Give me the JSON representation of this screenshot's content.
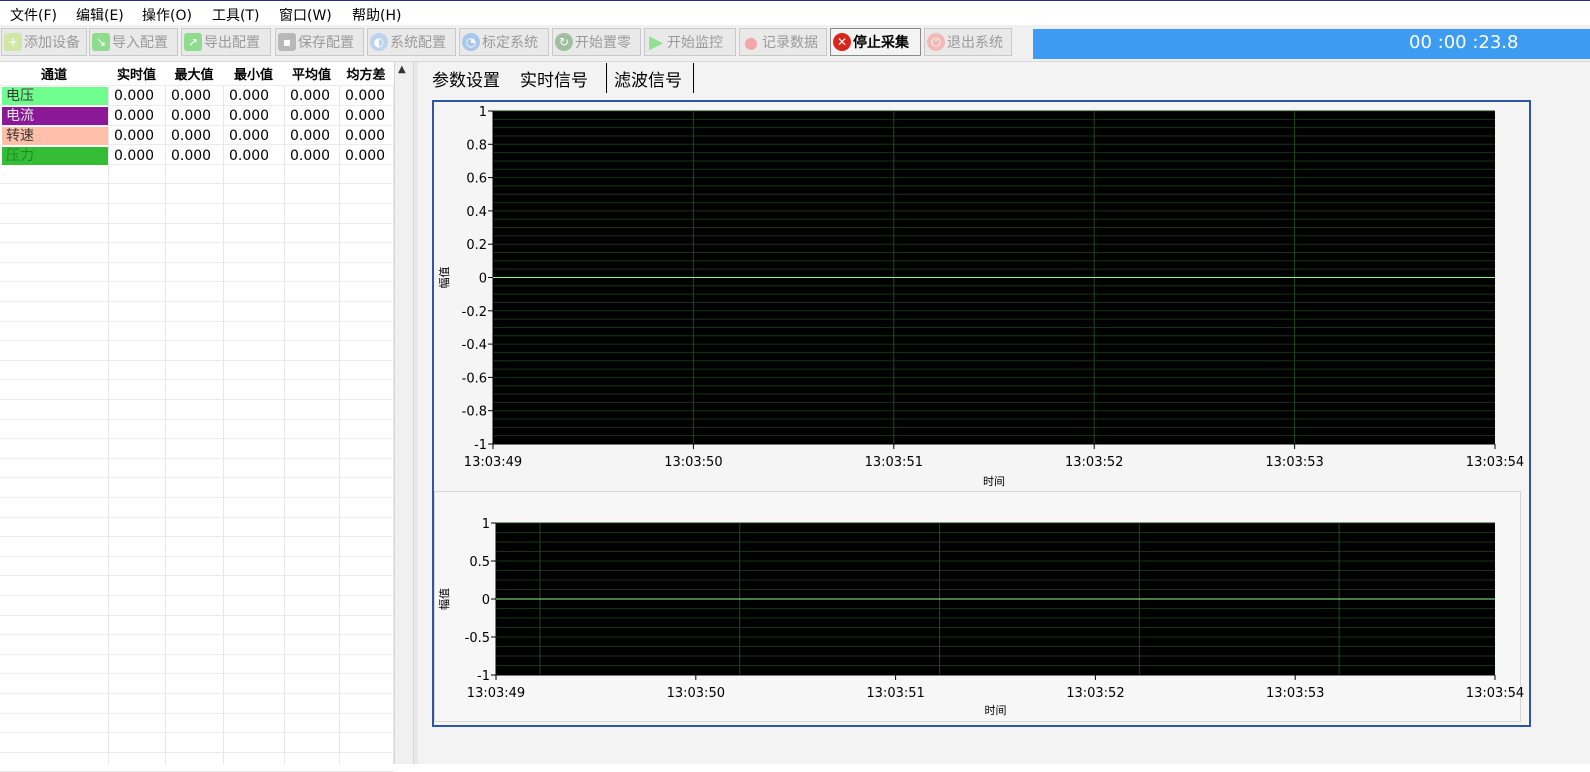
{
  "menu": [
    "文件(F)",
    "编辑(E)",
    "操作(O)",
    "工具(T)",
    "窗口(W)",
    "帮助(H)"
  ],
  "toolbar": [
    {
      "label": "添加设备",
      "icon": "add-device-icon",
      "state": "disabled"
    },
    {
      "label": "导入配置",
      "icon": "import-icon",
      "state": "disabled"
    },
    {
      "label": "导出配置",
      "icon": "export-icon",
      "state": "disabled"
    },
    {
      "label": "保存配置",
      "icon": "save-icon",
      "state": "disabled"
    },
    {
      "label": "系统配置",
      "icon": "gear-icon",
      "state": "disabled"
    },
    {
      "label": "标定系统",
      "icon": "calibrate-icon",
      "state": "disabled"
    },
    {
      "label": "开始置零",
      "icon": "refresh-icon",
      "state": "disabled"
    },
    {
      "label": "开始监控",
      "icon": "play-icon",
      "state": "disabled"
    },
    {
      "label": "记录数据",
      "icon": "record-icon",
      "state": "disabled"
    },
    {
      "label": "停止采集",
      "icon": "stop-icon",
      "state": "active"
    },
    {
      "label": "退出系统",
      "icon": "power-icon",
      "state": "disabled"
    }
  ],
  "timer": "00 :00 :23.8",
  "table": {
    "headers": [
      "通道",
      "实时值",
      "最大值",
      "最小值",
      "平均值",
      "均方差"
    ],
    "rows": [
      {
        "channel": "电压",
        "color": "#6fff8f",
        "text_color": "#3a3a3a",
        "values": [
          "0.000",
          "0.000",
          "0.000",
          "0.000",
          "0.000"
        ]
      },
      {
        "channel": "电流",
        "color": "#8b1896",
        "text_color": "#e6e6e6",
        "values": [
          "0.000",
          "0.000",
          "0.000",
          "0.000",
          "0.000"
        ]
      },
      {
        "channel": "转速",
        "color": "#ffbfa8",
        "text_color": "#3a3a3a",
        "values": [
          "0.000",
          "0.000",
          "0.000",
          "0.000",
          "0.000"
        ]
      },
      {
        "channel": "压力",
        "color": "#35be35",
        "text_color": "#1f8a1f",
        "values": [
          "0.000",
          "0.000",
          "0.000",
          "0.000",
          "0.000"
        ]
      }
    ]
  },
  "tabs": [
    "参数设置",
    "实时信号",
    "滤波信号"
  ],
  "active_tab": "实时信号",
  "chart_data": [
    {
      "type": "line",
      "xlabel": "时间",
      "ylabel": "幅值",
      "ylim": [
        -1,
        1
      ],
      "yticks": [
        1,
        0.8,
        0.6,
        0.4,
        0.2,
        0,
        -0.2,
        -0.4,
        -0.6,
        -0.8,
        -1
      ],
      "ytick_labels": [
        "1",
        "0.8",
        "0.6",
        "0.4",
        "0.2",
        "0",
        "-0.2",
        "-0.4",
        "-0.6",
        "-0.8",
        "-1"
      ],
      "xticks": [
        "13:03:49",
        "13:03:50",
        "13:03:51",
        "13:03:52",
        "13:03:53",
        "13:03:54"
      ],
      "series": [
        {
          "x": [
            "13:03:49",
            "13:03:54"
          ],
          "values": [
            0,
            0
          ],
          "color": "#80ff80"
        }
      ],
      "background": "#000000",
      "grid": true
    },
    {
      "type": "line",
      "xlabel": "时间",
      "ylabel": "幅值",
      "ylim": [
        -1,
        1
      ],
      "yticks": [
        1,
        0.5,
        0,
        -0.5,
        -1
      ],
      "ytick_labels": [
        "1",
        "0.5",
        "0",
        "-0.5",
        "-1"
      ],
      "xticks": [
        "13:03:49",
        "13:03:50",
        "13:03:51",
        "13:03:52",
        "13:03:53",
        "13:03:54"
      ],
      "series": [
        {
          "x": [
            "13:03:49",
            "13:03:54"
          ],
          "values": [
            0,
            0
          ],
          "color": "#80ff80"
        }
      ],
      "background": "#000000",
      "grid": true
    }
  ]
}
